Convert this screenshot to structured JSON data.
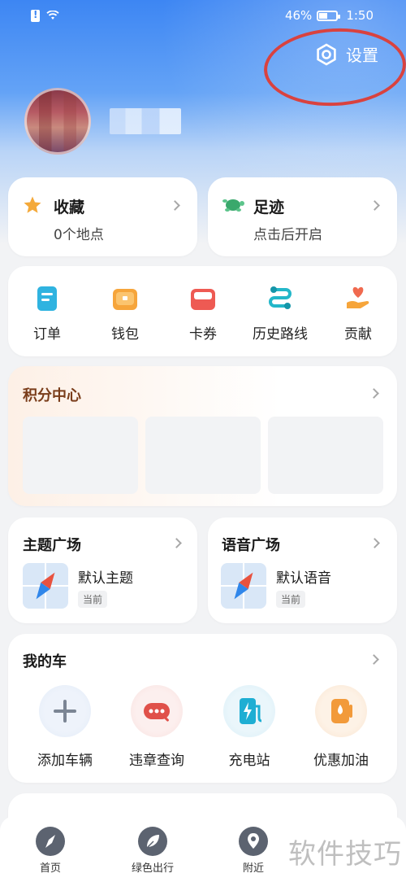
{
  "status_bar": {
    "battery": "46%",
    "time": "1:50"
  },
  "header": {
    "settings_label": "设置"
  },
  "favorites": {
    "title": "收藏",
    "subtitle": "0个地点"
  },
  "footprints": {
    "title": "足迹",
    "subtitle": "点击后开启"
  },
  "quick_actions": [
    {
      "label": "订单",
      "icon": "order-icon"
    },
    {
      "label": "钱包",
      "icon": "wallet-icon"
    },
    {
      "label": "卡券",
      "icon": "coupon-icon"
    },
    {
      "label": "历史路线",
      "icon": "history-route-icon"
    },
    {
      "label": "贡献",
      "icon": "contribute-icon"
    }
  ],
  "points": {
    "title": "积分中心"
  },
  "theme_square": {
    "title": "主题广场",
    "item": "默认主题",
    "tag": "当前"
  },
  "voice_square": {
    "title": "语音广场",
    "item": "默认语音",
    "tag": "当前"
  },
  "my_car": {
    "title": "我的车",
    "items": [
      {
        "label": "添加车辆",
        "icon": "add-vehicle-icon"
      },
      {
        "label": "违章查询",
        "icon": "violation-query-icon"
      },
      {
        "label": "充电站",
        "icon": "charging-station-icon"
      },
      {
        "label": "优惠加油",
        "icon": "fuel-discount-icon"
      }
    ]
  },
  "tabbar": [
    {
      "label": "首页",
      "icon": "compass-icon"
    },
    {
      "label": "绿色出行",
      "icon": "leaf-icon"
    },
    {
      "label": "附近",
      "icon": "location-pin-icon"
    }
  ],
  "watermark": "软件技巧",
  "colors": {
    "accent": "#3d86f3",
    "highlight_ring": "#d9423f",
    "background": "#f2f3f5"
  }
}
